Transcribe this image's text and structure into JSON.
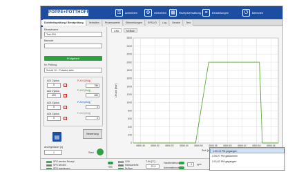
{
  "header": {
    "brand": "POPPE+POTTHOFF",
    "buttons": [
      {
        "label": "Anmelden",
        "icon": "user-lock-icon"
      },
      {
        "label": "Abmelden",
        "icon": "user-logout-icon"
      },
      {
        "label": "Rezeptverwaltung",
        "icon": "folder-icon"
      },
      {
        "label": "Einstellungen",
        "icon": "sliders-icon"
      },
      {
        "label": "Beenden",
        "icon": "power-icon"
      }
    ]
  },
  "tabs": [
    "Dichtheitsprüfung / Berstprüfung",
    "Verhalten",
    "Prozesswerte",
    "Störmeldungen",
    "SPS-I/O",
    "Log",
    "Service",
    "Test"
  ],
  "form": {
    "recipe_label": "Rezeptname",
    "recipe_value": "Test-004",
    "barcode_label": "Barcode",
    "barcode_value": "",
    "release_button": "Freigeben",
    "step_label": "Nr. Prüfung",
    "step_value": "Schritt 10 - Pulsator aktiv"
  },
  "counters": [
    {
      "label": "A01 Zyklus",
      "value": "0"
    },
    {
      "label": "A02 Zyklus",
      "value": "400"
    },
    {
      "label": "A03 Zyklus",
      "value": "0"
    },
    {
      "label": "A04 Zyklus",
      "value": "0"
    }
  ],
  "pressure": {
    "p1_label": "P-A01 [kN/g]",
    "p1_value": "786",
    "p2_label": "P-A02 [kN/g]",
    "p2_value": "484",
    "p3_label": "P-A03 [kN/g]",
    "p3_value": "0",
    "p4_label": "P-A04 [kN/g]",
    "p4_value": "0"
  },
  "actions": {
    "evaluate": "Bewertung",
    "display_label": "Anzeigedauer [s]",
    "display_value": "1",
    "start_label": "Start"
  },
  "chart_tabs": [
    "CN0",
    "Nr.Bow"
  ],
  "chart_data": {
    "type": "line",
    "xlabel": "Zeit [s]",
    "ylabel": "Druck [bar]",
    "x_ticks": [
      "6866.48",
      "6866.50",
      "6866.52",
      "6866.54",
      "6866.56",
      "6866.58",
      "6866.60",
      "6866.62",
      "6866.64",
      "6866.66"
    ],
    "y_ticks": [
      "2600",
      "2400",
      "2200",
      "2000",
      "1800",
      "1600",
      "1400",
      "1200",
      "1000",
      "800",
      "600",
      "400",
      "200",
      "0"
    ],
    "ylim": [
      0,
      2600
    ],
    "series": [
      {
        "color": "#5aa832",
        "points": [
          [
            0,
            0
          ],
          [
            0.43,
            0
          ],
          [
            0.52,
            2000
          ],
          [
            0.87,
            2000
          ],
          [
            0.89,
            0
          ],
          [
            1,
            0
          ]
        ]
      }
    ]
  },
  "bottom": {
    "status_labels": [
      "SPS senden Rezept",
      "SPS senden",
      "SPS empfangen",
      "CN0",
      "Messschleife",
      "Nr.Bow",
      "T-Kit [°C]",
      "Handbedienung",
      "Automatikmodus"
    ],
    "temp_value": "22.0",
    "ppm_value": "3",
    "ppm_unit": "ppm",
    "side_value": "+5%"
  },
  "log": [
    {
      "text": "1:00:13 PM gegangen",
      "selected": true
    },
    {
      "text": "2:00:27 PM gekommen",
      "selected": false
    },
    {
      "text": "2:01:02 PM gegangen",
      "selected": false
    }
  ]
}
